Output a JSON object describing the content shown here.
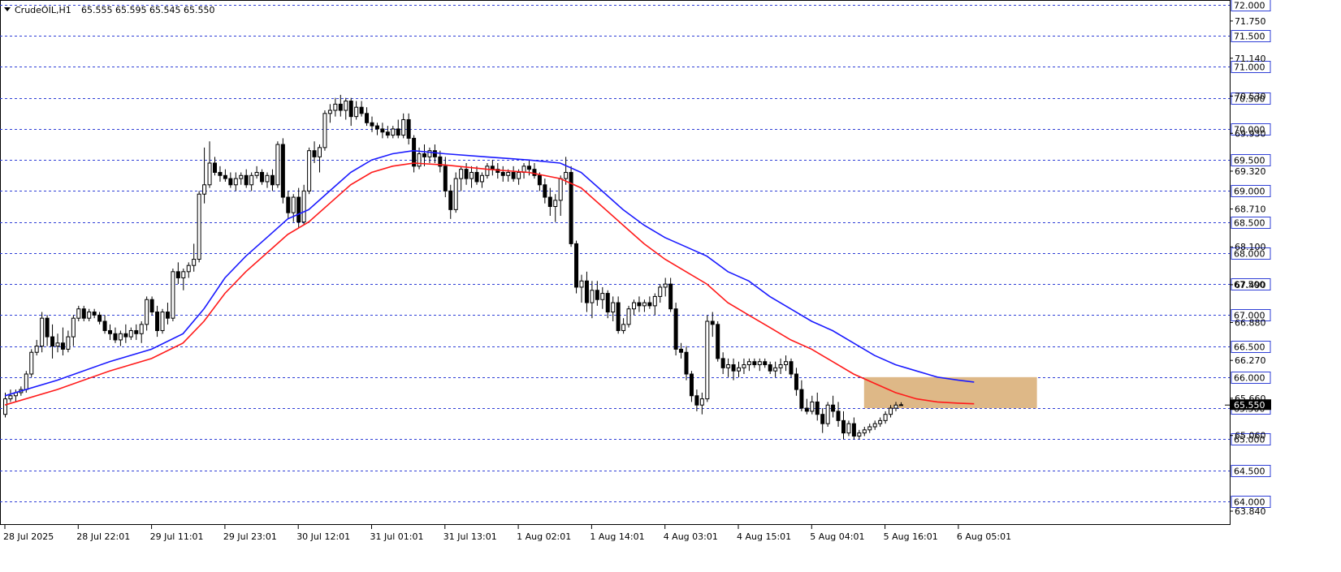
{
  "header": {
    "symbol": "CrudeOIL,H1",
    "ohlc": "65.555 65.595 65.545 65.550"
  },
  "colors": {
    "grid": "#2f3fd6",
    "candle_stroke": "#000000",
    "bull_fill": "#ffffff",
    "bear_fill": "#000000",
    "ema_fast": "#1a1aff",
    "ema_slow": "#ff1a1a",
    "zone": "#deb887",
    "label_fill": "#ffffff",
    "current_price_label": "#000000"
  },
  "chart_data": {
    "type": "candlestick",
    "y_range": [
      63.84,
      72.0
    ],
    "grid_levels": [
      72.0,
      71.5,
      71.0,
      70.5,
      70.0,
      69.5,
      69.0,
      68.5,
      68.0,
      67.5,
      67.0,
      66.5,
      66.0,
      65.5,
      65.0,
      64.5,
      64.0
    ],
    "level_labels": [
      "72.000",
      "71.500",
      "71.000",
      "70.500",
      "70.000",
      "69.500",
      "69.000",
      "68.500",
      "68.000",
      "67.500",
      "67.000",
      "66.500",
      "66.000",
      "65.500",
      "65.000",
      "64.500",
      "64.000"
    ],
    "tick_values": [
      71.74,
      71.14,
      70.53,
      69.93,
      69.32,
      68.71,
      68.1,
      67.49,
      66.88,
      66.27,
      65.66,
      65.06,
      63.84
    ],
    "tick_labels": [
      "71.750",
      "71.140",
      "70.530",
      "69.930",
      "69.320",
      "68.710",
      "68.100",
      "67.490",
      "66.880",
      "66.270",
      "65.660",
      "65.060",
      "63.840"
    ],
    "current_price": 65.55,
    "current_price_label": "65.550",
    "x_labels": [
      "28 Jul 2025",
      "28 Jul 22:01",
      "29 Jul 11:01",
      "29 Jul 23:01",
      "30 Jul 12:01",
      "31 Jul 01:01",
      "31 Jul 13:01",
      "1 Aug 02:01",
      "1 Aug 14:01",
      "4 Aug 03:01",
      "4 Aug 15:01",
      "5 Aug 04:01",
      "5 Aug 16:01",
      "6 Aug 05:01"
    ],
    "x_label_bars": [
      0,
      14,
      28,
      42,
      56,
      70,
      84,
      98,
      112,
      126,
      140,
      154,
      168,
      182
    ],
    "zone": {
      "start_bar": 164,
      "end_bar": 197,
      "low": 65.5,
      "high": 66.0
    },
    "candles": [
      [
        65.4,
        65.75,
        65.35,
        65.65
      ],
      [
        65.65,
        65.8,
        65.6,
        65.7
      ],
      [
        65.7,
        65.8,
        65.6,
        65.75
      ],
      [
        65.75,
        65.85,
        65.7,
        65.8
      ],
      [
        65.8,
        66.1,
        65.75,
        66.05
      ],
      [
        66.05,
        66.45,
        66.0,
        66.4
      ],
      [
        66.4,
        66.6,
        66.35,
        66.5
      ],
      [
        66.5,
        67.05,
        66.4,
        66.95
      ],
      [
        66.95,
        67.0,
        66.5,
        66.65
      ],
      [
        66.65,
        66.85,
        66.3,
        66.5
      ],
      [
        66.5,
        66.7,
        66.4,
        66.55
      ],
      [
        66.55,
        66.8,
        66.35,
        66.45
      ],
      [
        66.45,
        66.75,
        66.4,
        66.65
      ],
      [
        66.65,
        67.0,
        66.5,
        66.95
      ],
      [
        66.95,
        67.15,
        66.9,
        67.1
      ],
      [
        67.1,
        67.15,
        66.9,
        66.95
      ],
      [
        66.95,
        67.1,
        66.9,
        67.05
      ],
      [
        67.05,
        67.1,
        66.95,
        67.0
      ],
      [
        67.0,
        67.05,
        66.85,
        66.9
      ],
      [
        66.9,
        67.0,
        66.7,
        66.75
      ],
      [
        66.75,
        66.85,
        66.6,
        66.7
      ],
      [
        66.7,
        66.8,
        66.55,
        66.6
      ],
      [
        66.6,
        66.75,
        66.5,
        66.7
      ],
      [
        66.7,
        66.85,
        66.55,
        66.65
      ],
      [
        66.65,
        66.8,
        66.6,
        66.75
      ],
      [
        66.75,
        66.85,
        66.6,
        66.7
      ],
      [
        66.7,
        66.9,
        66.55,
        66.85
      ],
      [
        66.85,
        67.3,
        66.75,
        67.25
      ],
      [
        67.25,
        67.3,
        67.0,
        67.05
      ],
      [
        67.05,
        67.15,
        66.65,
        66.75
      ],
      [
        66.75,
        67.1,
        66.7,
        67.05
      ],
      [
        67.05,
        67.2,
        66.85,
        66.95
      ],
      [
        66.95,
        67.75,
        66.9,
        67.7
      ],
      [
        67.7,
        67.85,
        67.5,
        67.6
      ],
      [
        67.6,
        67.75,
        67.4,
        67.7
      ],
      [
        67.7,
        67.85,
        67.6,
        67.8
      ],
      [
        67.8,
        68.15,
        67.7,
        67.9
      ],
      [
        67.9,
        69.0,
        67.85,
        68.95
      ],
      [
        68.95,
        69.7,
        68.8,
        69.1
      ],
      [
        69.1,
        69.8,
        69.05,
        69.45
      ],
      [
        69.45,
        69.55,
        69.25,
        69.3
      ],
      [
        69.3,
        69.4,
        69.15,
        69.25
      ],
      [
        69.25,
        69.35,
        69.15,
        69.2
      ],
      [
        69.2,
        69.3,
        69.05,
        69.1
      ],
      [
        69.1,
        69.3,
        69.0,
        69.2
      ],
      [
        69.2,
        69.3,
        69.1,
        69.25
      ],
      [
        69.25,
        69.35,
        69.05,
        69.1
      ],
      [
        69.1,
        69.3,
        69.0,
        69.25
      ],
      [
        69.25,
        69.4,
        69.2,
        69.3
      ],
      [
        69.3,
        69.35,
        69.1,
        69.15
      ],
      [
        69.15,
        69.3,
        69.05,
        69.25
      ],
      [
        69.25,
        69.35,
        69.0,
        69.1
      ],
      [
        69.1,
        69.8,
        69.05,
        69.75
      ],
      [
        69.75,
        69.85,
        68.8,
        68.9
      ],
      [
        68.9,
        69.0,
        68.55,
        68.65
      ],
      [
        68.65,
        68.95,
        68.5,
        68.9
      ],
      [
        68.9,
        69.05,
        68.4,
        68.5
      ],
      [
        68.5,
        69.1,
        68.45,
        69.0
      ],
      [
        69.0,
        69.7,
        68.95,
        69.65
      ],
      [
        69.65,
        69.8,
        69.45,
        69.55
      ],
      [
        69.55,
        69.75,
        69.3,
        69.7
      ],
      [
        69.7,
        70.3,
        69.65,
        70.25
      ],
      [
        70.25,
        70.4,
        70.1,
        70.3
      ],
      [
        70.3,
        70.5,
        70.2,
        70.4
      ],
      [
        70.4,
        70.55,
        70.2,
        70.3
      ],
      [
        70.3,
        70.5,
        70.15,
        70.45
      ],
      [
        70.45,
        70.5,
        70.05,
        70.2
      ],
      [
        70.2,
        70.45,
        70.15,
        70.35
      ],
      [
        70.35,
        70.45,
        70.2,
        70.25
      ],
      [
        70.25,
        70.35,
        70.05,
        70.1
      ],
      [
        70.1,
        70.2,
        69.95,
        70.05
      ],
      [
        70.05,
        70.1,
        69.9,
        70.0
      ],
      [
        70.0,
        70.1,
        69.85,
        69.95
      ],
      [
        69.95,
        70.05,
        69.85,
        69.9
      ],
      [
        69.9,
        70.05,
        69.85,
        70.0
      ],
      [
        70.0,
        70.15,
        69.85,
        69.9
      ],
      [
        69.9,
        70.25,
        69.85,
        70.15
      ],
      [
        70.15,
        70.25,
        69.75,
        69.85
      ],
      [
        69.85,
        69.9,
        69.3,
        69.4
      ],
      [
        69.4,
        69.7,
        69.35,
        69.6
      ],
      [
        69.6,
        69.75,
        69.4,
        69.55
      ],
      [
        69.55,
        69.7,
        69.45,
        69.65
      ],
      [
        69.65,
        69.75,
        69.45,
        69.55
      ],
      [
        69.55,
        69.65,
        69.3,
        69.4
      ],
      [
        69.4,
        69.55,
        68.9,
        69.0
      ],
      [
        69.0,
        69.1,
        68.55,
        68.7
      ],
      [
        68.7,
        69.3,
        68.65,
        69.2
      ],
      [
        69.2,
        69.4,
        69.0,
        69.35
      ],
      [
        69.35,
        69.45,
        69.1,
        69.2
      ],
      [
        69.2,
        69.4,
        69.05,
        69.3
      ],
      [
        69.3,
        69.4,
        69.1,
        69.15
      ],
      [
        69.15,
        69.3,
        69.05,
        69.25
      ],
      [
        69.25,
        69.45,
        69.2,
        69.4
      ],
      [
        69.4,
        69.5,
        69.25,
        69.35
      ],
      [
        69.35,
        69.45,
        69.2,
        69.3
      ],
      [
        69.3,
        69.4,
        69.15,
        69.25
      ],
      [
        69.25,
        69.35,
        69.15,
        69.3
      ],
      [
        69.3,
        69.4,
        69.15,
        69.2
      ],
      [
        69.2,
        69.35,
        69.1,
        69.3
      ],
      [
        69.3,
        69.45,
        69.2,
        69.4
      ],
      [
        69.4,
        69.5,
        69.25,
        69.35
      ],
      [
        69.35,
        69.45,
        69.2,
        69.25
      ],
      [
        69.25,
        69.3,
        69.0,
        69.1
      ],
      [
        69.1,
        69.2,
        68.8,
        68.9
      ],
      [
        68.9,
        69.05,
        68.6,
        68.75
      ],
      [
        68.75,
        68.95,
        68.5,
        68.85
      ],
      [
        68.85,
        69.25,
        68.6,
        69.2
      ],
      [
        69.2,
        69.55,
        69.1,
        69.3
      ],
      [
        69.3,
        69.4,
        68.1,
        68.15
      ],
      [
        68.15,
        68.2,
        67.35,
        67.45
      ],
      [
        67.45,
        67.65,
        67.2,
        67.55
      ],
      [
        67.55,
        67.7,
        67.05,
        67.2
      ],
      [
        67.2,
        67.55,
        66.95,
        67.4
      ],
      [
        67.4,
        67.55,
        67.15,
        67.25
      ],
      [
        67.25,
        67.45,
        67.1,
        67.35
      ],
      [
        67.35,
        67.4,
        66.95,
        67.05
      ],
      [
        67.05,
        67.3,
        66.9,
        67.2
      ],
      [
        67.2,
        67.3,
        66.7,
        66.75
      ],
      [
        66.75,
        66.95,
        66.7,
        66.85
      ],
      [
        66.85,
        67.15,
        66.8,
        67.1
      ],
      [
        67.1,
        67.25,
        67.0,
        67.2
      ],
      [
        67.2,
        67.3,
        67.05,
        67.15
      ],
      [
        67.15,
        67.25,
        67.05,
        67.2
      ],
      [
        67.2,
        67.3,
        67.1,
        67.15
      ],
      [
        67.15,
        67.35,
        67.0,
        67.3
      ],
      [
        67.3,
        67.5,
        67.2,
        67.45
      ],
      [
        67.45,
        67.6,
        67.3,
        67.5
      ],
      [
        67.5,
        67.6,
        67.05,
        67.1
      ],
      [
        67.1,
        67.2,
        66.35,
        66.45
      ],
      [
        66.45,
        66.55,
        66.3,
        66.4
      ],
      [
        66.4,
        66.5,
        65.95,
        66.05
      ],
      [
        66.05,
        66.1,
        65.6,
        65.7
      ],
      [
        65.7,
        65.8,
        65.45,
        65.55
      ],
      [
        65.55,
        65.75,
        65.4,
        65.65
      ],
      [
        65.65,
        67.0,
        65.6,
        66.9
      ],
      [
        66.9,
        67.05,
        66.65,
        66.85
      ],
      [
        66.85,
        66.9,
        66.25,
        66.3
      ],
      [
        66.3,
        66.4,
        66.05,
        66.15
      ],
      [
        66.15,
        66.3,
        66.0,
        66.2
      ],
      [
        66.2,
        66.3,
        65.95,
        66.1
      ],
      [
        66.1,
        66.25,
        66.0,
        66.15
      ],
      [
        66.15,
        66.3,
        66.05,
        66.2
      ],
      [
        66.2,
        66.3,
        66.1,
        66.25
      ],
      [
        66.25,
        66.3,
        66.15,
        66.2
      ],
      [
        66.2,
        66.3,
        66.1,
        66.25
      ],
      [
        66.25,
        66.3,
        66.15,
        66.2
      ],
      [
        66.2,
        66.25,
        66.05,
        66.1
      ],
      [
        66.1,
        66.25,
        66.0,
        66.15
      ],
      [
        66.15,
        66.3,
        66.05,
        66.2
      ],
      [
        66.2,
        66.35,
        66.1,
        66.25
      ],
      [
        66.25,
        66.3,
        66.0,
        66.05
      ],
      [
        66.05,
        66.15,
        65.7,
        65.8
      ],
      [
        65.8,
        65.95,
        65.45,
        65.5
      ],
      [
        65.5,
        65.65,
        65.4,
        65.45
      ],
      [
        65.45,
        65.7,
        65.4,
        65.6
      ],
      [
        65.6,
        65.75,
        65.3,
        65.4
      ],
      [
        65.4,
        65.5,
        65.1,
        65.25
      ],
      [
        65.25,
        65.6,
        65.2,
        65.55
      ],
      [
        65.55,
        65.7,
        65.35,
        65.45
      ],
      [
        65.45,
        65.6,
        65.2,
        65.3
      ],
      [
        65.3,
        65.45,
        65.0,
        65.1
      ],
      [
        65.1,
        65.3,
        65.05,
        65.25
      ],
      [
        65.25,
        65.35,
        65.0,
        65.05
      ],
      [
        65.05,
        65.15,
        65.0,
        65.1
      ],
      [
        65.1,
        65.2,
        65.05,
        65.15
      ],
      [
        65.15,
        65.25,
        65.1,
        65.2
      ],
      [
        65.2,
        65.3,
        65.15,
        65.25
      ],
      [
        65.25,
        65.35,
        65.2,
        65.3
      ],
      [
        65.3,
        65.45,
        65.25,
        65.4
      ],
      [
        65.4,
        65.55,
        65.35,
        65.5
      ],
      [
        65.5,
        65.6,
        65.45,
        65.55
      ],
      [
        65.555,
        65.595,
        65.545,
        65.55
      ]
    ],
    "ema_fast": [
      [
        0,
        65.7
      ],
      [
        10,
        65.95
      ],
      [
        20,
        66.25
      ],
      [
        28,
        66.45
      ],
      [
        34,
        66.7
      ],
      [
        38,
        67.1
      ],
      [
        42,
        67.6
      ],
      [
        46,
        67.95
      ],
      [
        50,
        68.25
      ],
      [
        54,
        68.55
      ],
      [
        58,
        68.7
      ],
      [
        62,
        69.0
      ],
      [
        66,
        69.3
      ],
      [
        70,
        69.5
      ],
      [
        74,
        69.6
      ],
      [
        78,
        69.65
      ],
      [
        84,
        69.6
      ],
      [
        92,
        69.55
      ],
      [
        100,
        69.5
      ],
      [
        106,
        69.45
      ],
      [
        110,
        69.3
      ],
      [
        114,
        69.0
      ],
      [
        118,
        68.7
      ],
      [
        122,
        68.45
      ],
      [
        126,
        68.25
      ],
      [
        130,
        68.1
      ],
      [
        134,
        67.95
      ],
      [
        138,
        67.7
      ],
      [
        142,
        67.55
      ],
      [
        146,
        67.3
      ],
      [
        150,
        67.1
      ],
      [
        154,
        66.9
      ],
      [
        158,
        66.75
      ],
      [
        162,
        66.55
      ],
      [
        166,
        66.35
      ],
      [
        170,
        66.2
      ],
      [
        174,
        66.1
      ],
      [
        178,
        66.0
      ],
      [
        182,
        65.95
      ],
      [
        185,
        65.92
      ]
    ],
    "ema_slow": [
      [
        0,
        65.55
      ],
      [
        10,
        65.8
      ],
      [
        20,
        66.1
      ],
      [
        28,
        66.3
      ],
      [
        34,
        66.55
      ],
      [
        38,
        66.9
      ],
      [
        42,
        67.35
      ],
      [
        46,
        67.7
      ],
      [
        50,
        68.0
      ],
      [
        54,
        68.3
      ],
      [
        58,
        68.5
      ],
      [
        62,
        68.8
      ],
      [
        66,
        69.1
      ],
      [
        70,
        69.3
      ],
      [
        74,
        69.4
      ],
      [
        78,
        69.45
      ],
      [
        84,
        69.42
      ],
      [
        92,
        69.35
      ],
      [
        100,
        69.3
      ],
      [
        106,
        69.2
      ],
      [
        110,
        69.05
      ],
      [
        114,
        68.75
      ],
      [
        118,
        68.45
      ],
      [
        122,
        68.15
      ],
      [
        126,
        67.9
      ],
      [
        130,
        67.7
      ],
      [
        134,
        67.5
      ],
      [
        138,
        67.2
      ],
      [
        142,
        67.0
      ],
      [
        146,
        66.8
      ],
      [
        150,
        66.6
      ],
      [
        154,
        66.45
      ],
      [
        158,
        66.25
      ],
      [
        162,
        66.05
      ],
      [
        166,
        65.9
      ],
      [
        170,
        65.75
      ],
      [
        174,
        65.65
      ],
      [
        178,
        65.6
      ],
      [
        182,
        65.58
      ],
      [
        185,
        65.57
      ]
    ]
  }
}
